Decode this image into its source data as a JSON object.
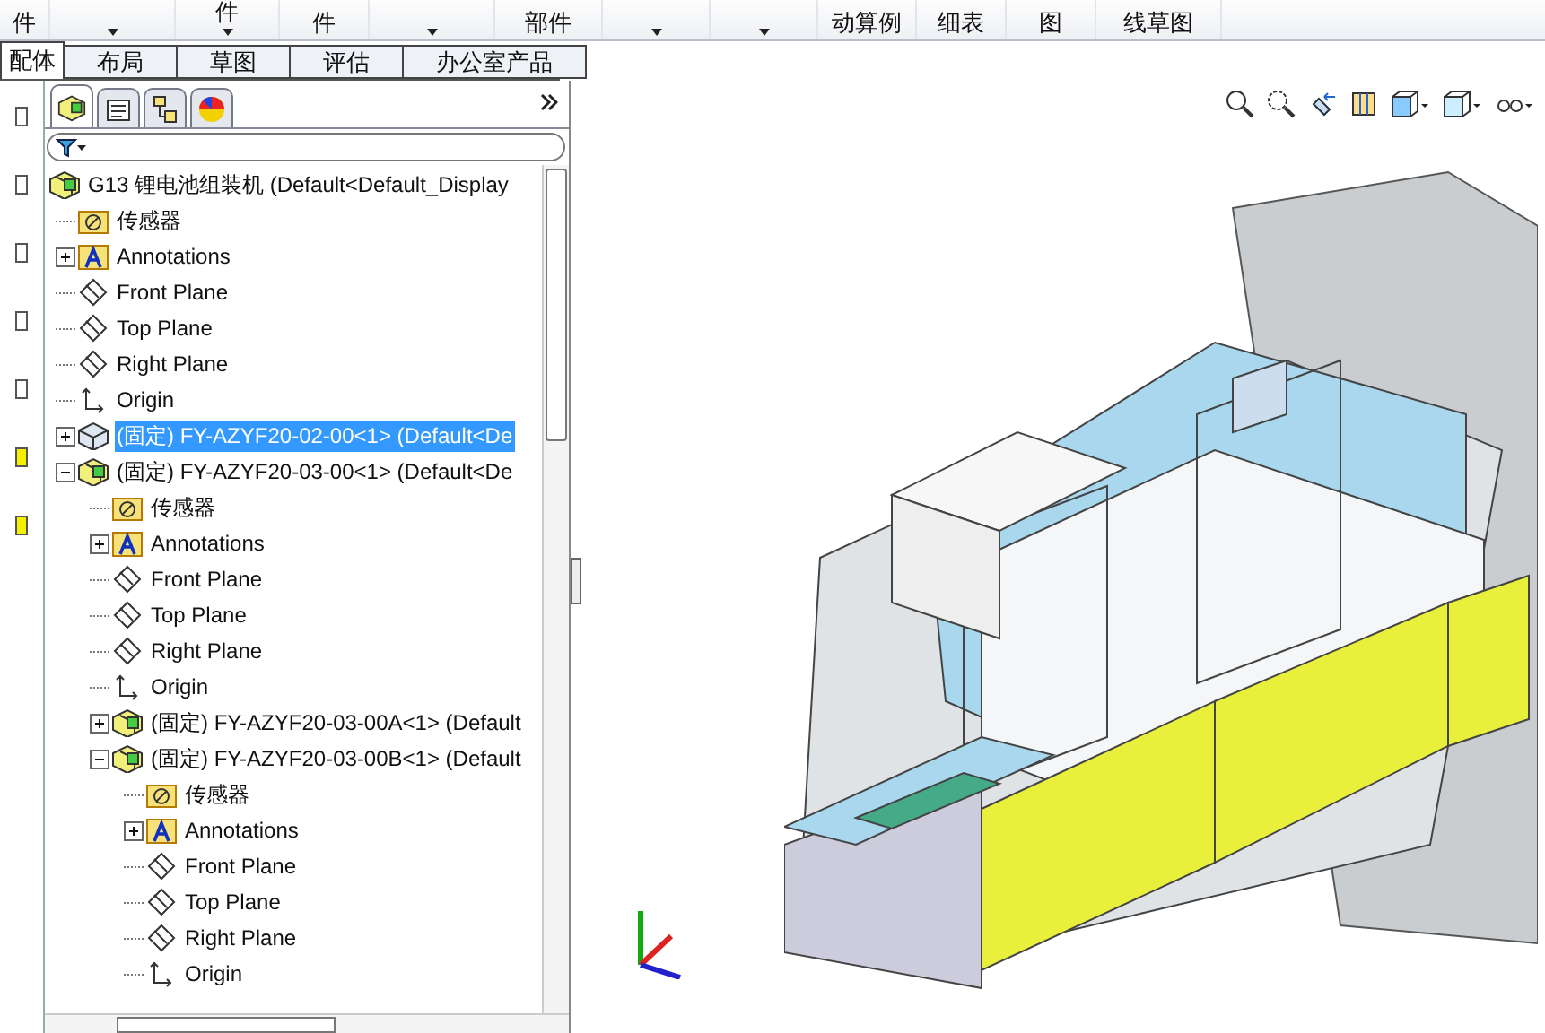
{
  "ribbon": {
    "items": [
      {
        "label": "件",
        "dropdown": false
      },
      {
        "dropdown": true
      },
      {
        "label": "件",
        "dropdown": true
      },
      {
        "label": "件",
        "dropdown": false
      },
      {
        "dropdown": true
      },
      {
        "label": "部件",
        "dropdown": false
      },
      {
        "dropdown": true
      },
      {
        "dropdown": true
      },
      {
        "label": "动算例",
        "dropdown": false
      },
      {
        "label": "细表",
        "dropdown": false
      },
      {
        "label": "图",
        "dropdown": false
      },
      {
        "label": "线草图",
        "dropdown": false
      }
    ]
  },
  "tabs": [
    {
      "label": "配体",
      "selected": true
    },
    {
      "label": "布局",
      "selected": false
    },
    {
      "label": "草图",
      "selected": false
    },
    {
      "label": "评估",
      "selected": false
    },
    {
      "label": "办公室产品",
      "selected": false
    }
  ],
  "manager_tabs": [
    {
      "kind": "tree",
      "selected": true
    },
    {
      "kind": "property",
      "selected": false
    },
    {
      "kind": "config",
      "selected": false
    },
    {
      "kind": "appearance",
      "selected": false
    }
  ],
  "tree": [
    {
      "kind": "assembly",
      "label": "G13 锂电池组装机  (Default<Default_Display",
      "selected": false,
      "children": [
        {
          "kind": "sensors",
          "label": "传感器"
        },
        {
          "kind": "annotations",
          "label": "Annotations",
          "expanded": false
        },
        {
          "kind": "plane",
          "label": "Front Plane"
        },
        {
          "kind": "plane",
          "label": "Top Plane"
        },
        {
          "kind": "plane",
          "label": "Right Plane"
        },
        {
          "kind": "origin",
          "label": "Origin"
        },
        {
          "kind": "part",
          "label": "(固定) FY-AZYF20-02-00<1> (Default<De",
          "selected": true,
          "expanded": false
        },
        {
          "kind": "assembly",
          "label": "(固定) FY-AZYF20-03-00<1> (Default<De",
          "selected": false,
          "expanded": true,
          "children": [
            {
              "kind": "sensors",
              "label": "传感器"
            },
            {
              "kind": "annotations",
              "label": "Annotations",
              "expanded": false
            },
            {
              "kind": "plane",
              "label": "Front Plane"
            },
            {
              "kind": "plane",
              "label": "Top Plane"
            },
            {
              "kind": "plane",
              "label": "Right Plane"
            },
            {
              "kind": "origin",
              "label": "Origin"
            },
            {
              "kind": "assembly",
              "label": "(固定) FY-AZYF20-03-00A<1> (Default",
              "selected": false,
              "expanded": false
            },
            {
              "kind": "assembly",
              "label": "(固定) FY-AZYF20-03-00B<1> (Default",
              "selected": false,
              "expanded": true,
              "children": [
                {
                  "kind": "sensors",
                  "label": "传感器"
                },
                {
                  "kind": "annotations",
                  "label": "Annotations",
                  "expanded": false
                },
                {
                  "kind": "plane",
                  "label": "Front Plane"
                },
                {
                  "kind": "plane",
                  "label": "Top Plane"
                },
                {
                  "kind": "plane",
                  "label": "Right Plane"
                },
                {
                  "kind": "origin",
                  "label": "Origin"
                }
              ]
            }
          ]
        }
      ]
    }
  ]
}
